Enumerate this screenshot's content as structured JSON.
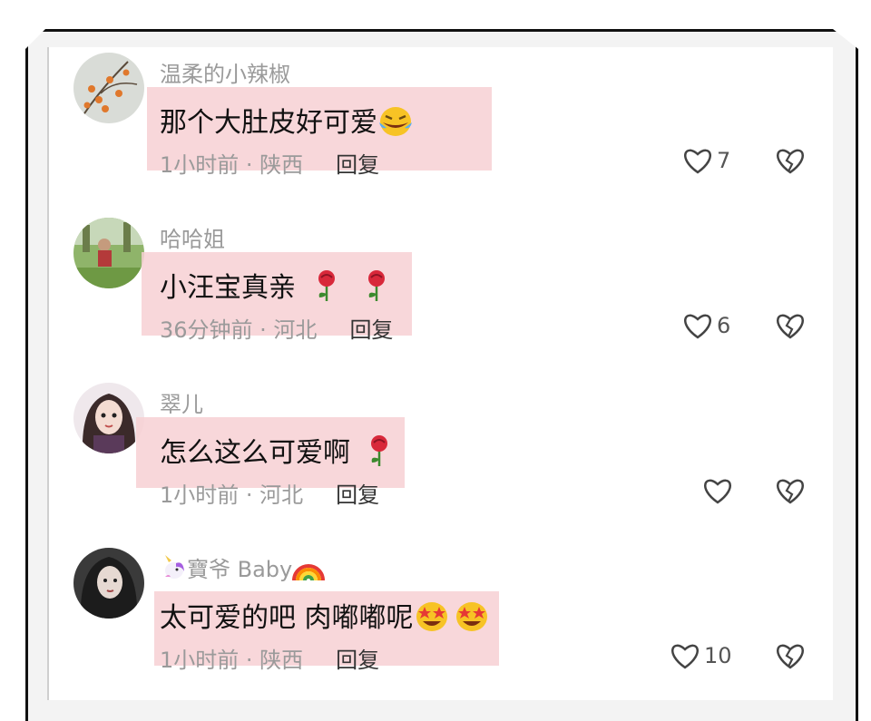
{
  "comments": [
    {
      "username": "温柔的小辣椒",
      "text": "那个大肚皮好可爱",
      "emojis": [
        "laughing-crying-face"
      ],
      "time_location": "1小时前 · 陕西",
      "reply_label": "回复",
      "likes": "7"
    },
    {
      "username": "哈哈姐",
      "text": "小汪宝真亲",
      "emojis": [
        "rose",
        "rose"
      ],
      "time_location": "36分钟前 · 河北",
      "reply_label": "回复",
      "likes": "6"
    },
    {
      "username": "翠儿",
      "text": "怎么这么可爱啊",
      "emojis": [
        "rose"
      ],
      "time_location": "1小时前 · 河北",
      "reply_label": "回复",
      "likes": ""
    },
    {
      "username": "寶爷 Baby",
      "username_prefix_emoji": "unicorn",
      "username_suffix_emoji": "rainbow",
      "text": "太可爱的吧 肉嘟嘟呢",
      "emojis": [
        "star-struck-face",
        "star-struck-face"
      ],
      "time_location": "1小时前 · 陕西",
      "reply_label": "回复",
      "likes": "10"
    }
  ],
  "colors": {
    "highlight": "#f7d0d4",
    "muted_text": "#9a9a9a",
    "body_text": "#111111"
  }
}
